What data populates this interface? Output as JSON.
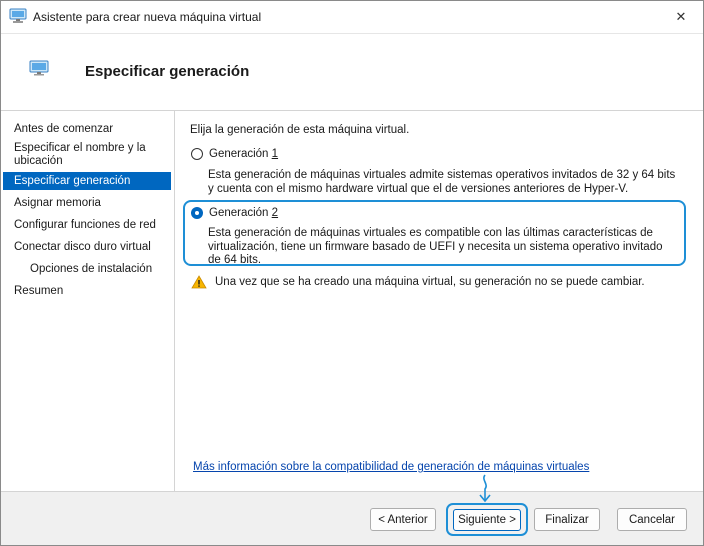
{
  "window": {
    "title": "Asistente para crear nueva máquina virtual",
    "close_glyph": "✕"
  },
  "header": {
    "title": "Especificar generación"
  },
  "sidebar": {
    "items": [
      {
        "label": "Antes de comenzar"
      },
      {
        "label": "Especificar el nombre y la ubicación"
      },
      {
        "label": "Especificar generación",
        "active": true
      },
      {
        "label": "Asignar memoria"
      },
      {
        "label": "Configurar funciones de red"
      },
      {
        "label": "Conectar disco duro virtual"
      },
      {
        "label": "Opciones de instalación"
      },
      {
        "label": "Resumen"
      }
    ]
  },
  "content": {
    "intro": "Elija la generación de esta máquina virtual.",
    "options": [
      {
        "label_prefix": "Generación ",
        "label_number": "1",
        "selected": false,
        "description": "Esta generación de máquinas virtuales admite sistemas operativos invitados de 32 y 64 bits y cuenta con el mismo hardware virtual que el de versiones anteriores de Hyper-V."
      },
      {
        "label_prefix": "Generación ",
        "label_number": "2",
        "selected": true,
        "description": "Esta generación de máquinas virtuales es compatible con las últimas características de virtualización, tiene un firmware basado de UEFI y necesita un sistema operativo invitado de 64 bits."
      }
    ],
    "warning": "Una vez que se ha creado una máquina virtual, su generación no se puede cambiar.",
    "more_info_link": "Más información sobre la compatibilidad de generación de máquinas virtuales"
  },
  "footer": {
    "back_label": "< Anterior",
    "next_label": "Siguiente >",
    "finish_label": "Finalizar",
    "cancel_label": "Cancelar"
  },
  "icons": {
    "app": "virtual-machine-icon",
    "warning": "warning-icon",
    "close": "close-icon"
  },
  "colors": {
    "accent": "#0067c0",
    "highlight": "#1e8fd6",
    "link": "#0645ad",
    "warning": "#f7b500"
  }
}
